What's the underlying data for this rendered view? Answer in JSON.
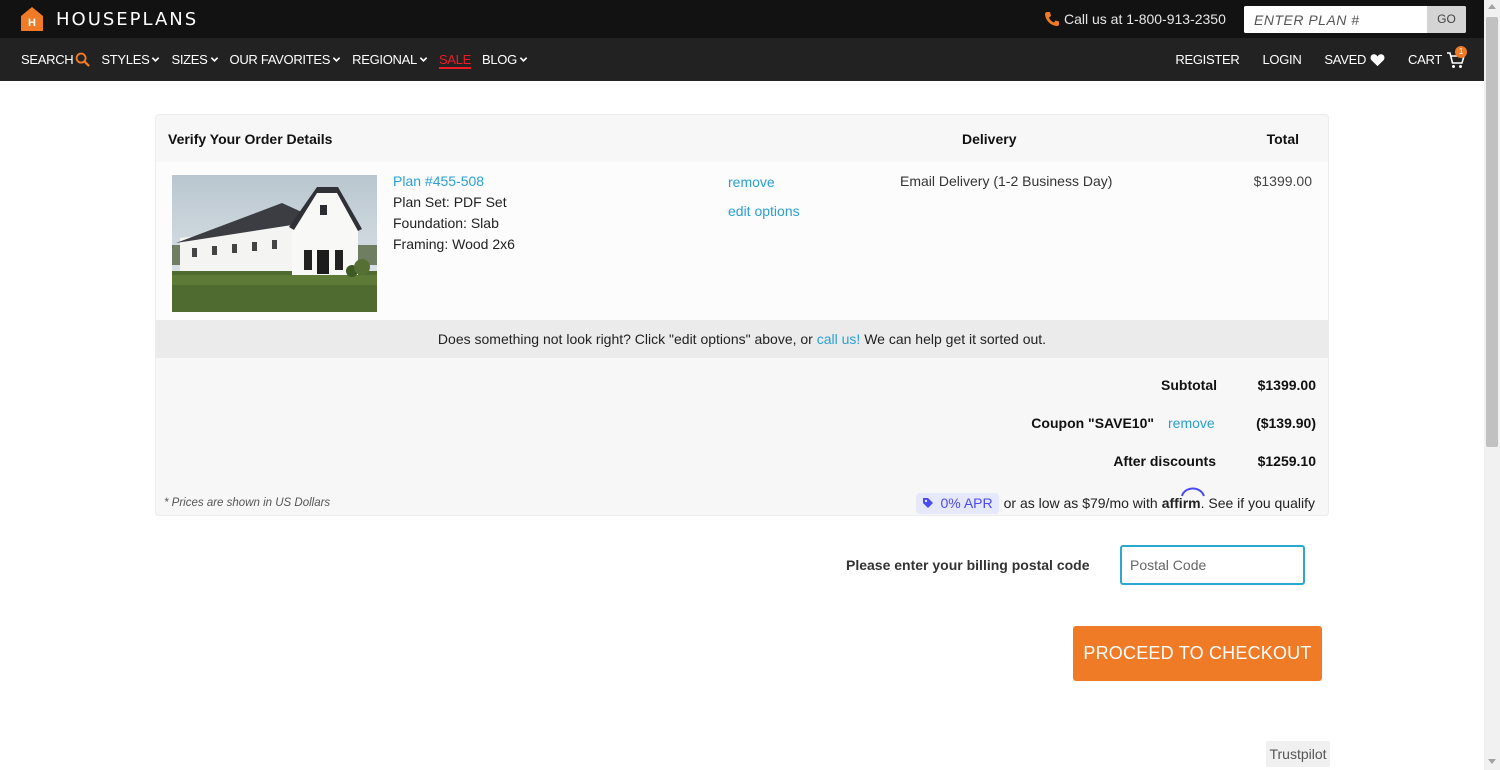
{
  "header": {
    "brand": "HOUSEPLANS",
    "call_text": "Call us at 1-800-913-2350",
    "plan_search_placeholder": "ENTER PLAN #",
    "go_label": "GO"
  },
  "nav": {
    "left": [
      {
        "label": "SEARCH"
      },
      {
        "label": "STYLES"
      },
      {
        "label": "SIZES"
      },
      {
        "label": "OUR FAVORITES"
      },
      {
        "label": "REGIONAL"
      },
      {
        "label": "SALE"
      },
      {
        "label": "BLOG"
      }
    ],
    "right": {
      "register": "REGISTER",
      "login": "LOGIN",
      "saved": "SAVED",
      "cart": "CART",
      "cart_count": "1"
    }
  },
  "order": {
    "headers": {
      "details": "Verify Your Order Details",
      "delivery": "Delivery",
      "total": "Total"
    },
    "item": {
      "plan": "Plan #455-508",
      "plan_set": "Plan Set: PDF Set",
      "foundation": "Foundation: Slab",
      "framing": "Framing: Wood 2x6",
      "remove": "remove",
      "edit_options": "edit options",
      "delivery": "Email Delivery (1-2 Business Day)",
      "price": "$1399.00"
    },
    "help": {
      "before": "Does something not look right?  Click \"edit options\" above, or ",
      "link": "call us!",
      "after": "  We can help get it sorted out."
    },
    "summary": {
      "subtotal_label": "Subtotal",
      "subtotal": "$1399.00",
      "coupon_label": "Coupon \"SAVE10\"",
      "coupon_remove": "remove",
      "coupon_value": "($139.90)",
      "after_label": "After discounts",
      "after_value": "$1259.10"
    },
    "prices_note": "* Prices are shown in US Dollars",
    "affirm": {
      "apr": "0% APR",
      "text": "or as low as $79/mo with",
      "brand": "affirm",
      "qualify": ". See if you qualify"
    }
  },
  "billing": {
    "label": "Please enter your billing postal code",
    "placeholder": "Postal Code"
  },
  "checkout_label": "PROCEED TO CHECKOUT",
  "trustpilot": "Trustpilot",
  "colors": {
    "accent": "#f07b27",
    "link": "#2a9fd6",
    "sale": "#ee1c25",
    "affirm": "#4a4af4"
  }
}
